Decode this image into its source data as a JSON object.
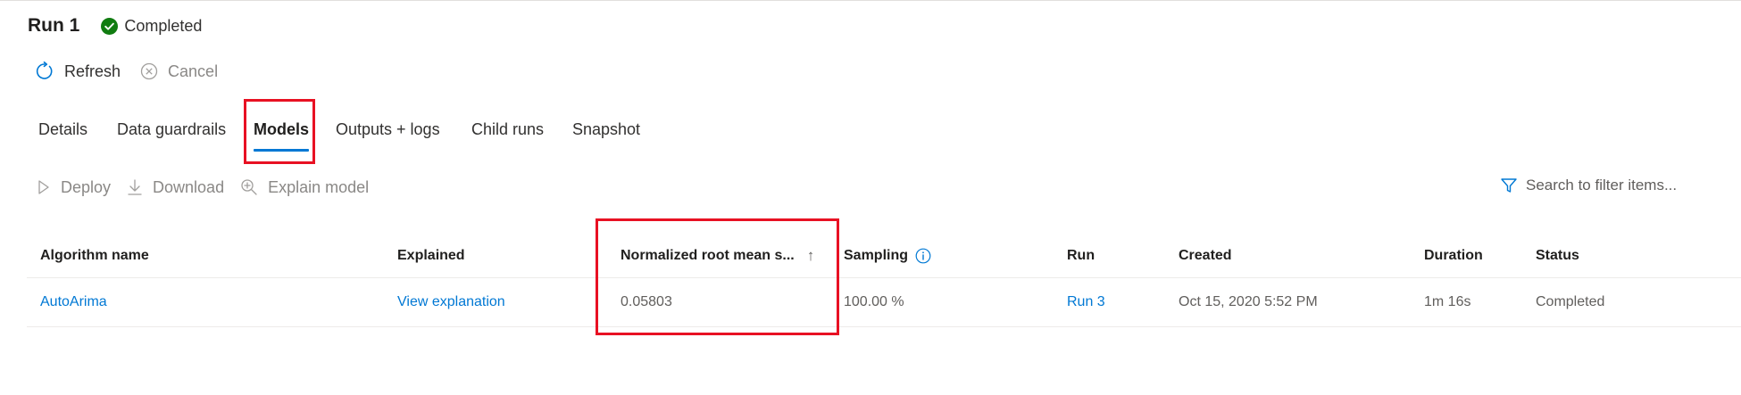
{
  "header": {
    "run_title": "Run 1",
    "status_text": "Completed",
    "status_color": "#107c10"
  },
  "command_bar": {
    "refresh_label": "Refresh",
    "cancel_label": "Cancel",
    "refresh_icon": "refresh-icon",
    "cancel_icon": "cancel-circle-icon"
  },
  "tabs": [
    {
      "label": "Details"
    },
    {
      "label": "Data guardrails"
    },
    {
      "label": "Models",
      "active": true
    },
    {
      "label": "Outputs + logs"
    },
    {
      "label": "Child runs"
    },
    {
      "label": "Snapshot"
    }
  ],
  "models_toolbar": {
    "deploy_label": "Deploy",
    "download_label": "Download",
    "explain_label": "Explain model",
    "search_placeholder": "Search to filter items..."
  },
  "table": {
    "columns": {
      "algorithm": "Algorithm name",
      "explained": "Explained",
      "metric": "Normalized root mean s...",
      "sampling": "Sampling",
      "run": "Run",
      "created": "Created",
      "duration": "Duration",
      "status": "Status"
    },
    "sort_indicator": "↑",
    "rows": [
      {
        "algorithm": "AutoArima",
        "explained": "View explanation",
        "metric": "0.05803",
        "sampling": "100.00 %",
        "run": "Run 3",
        "created": "Oct 15, 2020 5:52 PM",
        "duration": "1m 16s",
        "status": "Completed"
      }
    ]
  },
  "colors": {
    "accent": "#0078d4",
    "highlight": "#e81123"
  }
}
